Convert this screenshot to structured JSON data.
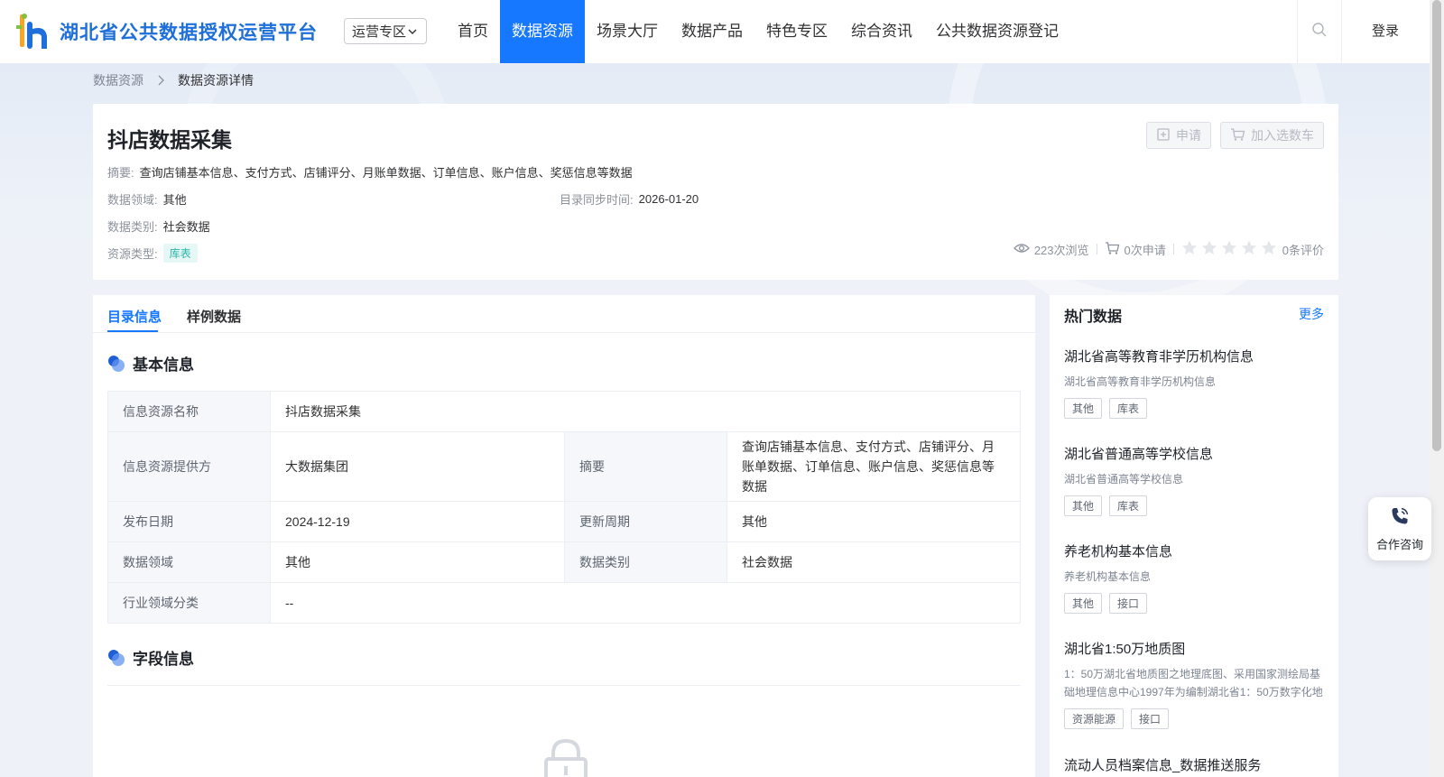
{
  "header": {
    "logo_text": "湖北省公共数据授权运营平台",
    "zone_select": "运营专区",
    "nav": [
      "首页",
      "数据资源",
      "场景大厅",
      "数据产品",
      "特色专区",
      "综合资讯",
      "公共数据资源登记"
    ],
    "active_nav": "数据资源",
    "login": "登录"
  },
  "breadcrumb": {
    "parent": "数据资源",
    "current": "数据资源详情"
  },
  "summary": {
    "title": "抖店数据采集",
    "apply_button": "申请",
    "cart_button": "加入选数车",
    "abstract_label": "摘要:",
    "abstract": "查询店铺基本信息、支付方式、店铺评分、月账单数据、订单信息、账户信息、奖惩信息等数据",
    "domain_label": "数据领域:",
    "domain": "其他",
    "sync_label": "目录同步时间:",
    "sync_time": "2026-01-20",
    "category_label": "数据类别:",
    "category": "社会数据",
    "type_label": "资源类型:",
    "type_tag": "库表",
    "views": "223次浏览",
    "applications": "0次申请",
    "rating_stars": 0,
    "reviews": "0条评价"
  },
  "tabs": [
    "目录信息",
    "样例数据"
  ],
  "basic_info": {
    "heading": "基本信息",
    "rows": [
      {
        "label": "信息资源名称",
        "value": "抖店数据采集"
      },
      {
        "label": "信息资源提供方",
        "value": "大数据集团",
        "label2": "摘要",
        "value2": "查询店铺基本信息、支付方式、店铺评分、月账单数据、订单信息、账户信息、奖惩信息等数据"
      },
      {
        "label": "发布日期",
        "value": "2024-12-19",
        "label2": "更新周期",
        "value2": "其他"
      },
      {
        "label": "数据领域",
        "value": "其他",
        "label2": "数据类别",
        "value2": "社会数据"
      },
      {
        "label": "行业领域分类",
        "value": "--"
      }
    ]
  },
  "field_info": {
    "heading": "字段信息"
  },
  "hot": {
    "heading": "热门数据",
    "more": "更多",
    "items": [
      {
        "title": "湖北省高等教育非学历机构信息",
        "desc": "湖北省高等教育非学历机构信息",
        "tags": [
          "其他",
          "库表"
        ]
      },
      {
        "title": "湖北省普通高等学校信息",
        "desc": "湖北省普通高等学校信息",
        "tags": [
          "其他",
          "库表"
        ]
      },
      {
        "title": "养老机构基本信息",
        "desc": "养老机构基本信息",
        "tags": [
          "其他",
          "接口"
        ]
      },
      {
        "title": "湖北省1:50万地质图",
        "desc": "1：50万湖北省地质图之地理底图、采用国家测绘局基础地理信息中心1997年为编制湖北省1：50万数字化地",
        "tags": [
          "资源能源",
          "接口"
        ]
      },
      {
        "title": "流动人员档案信息_数据推送服务",
        "desc": "",
        "tags": []
      }
    ]
  },
  "consult": "合作咨询",
  "colors": {
    "primary": "#1677ff",
    "tag_cyan": "#2bb5a8",
    "background": "#eef2f8"
  }
}
